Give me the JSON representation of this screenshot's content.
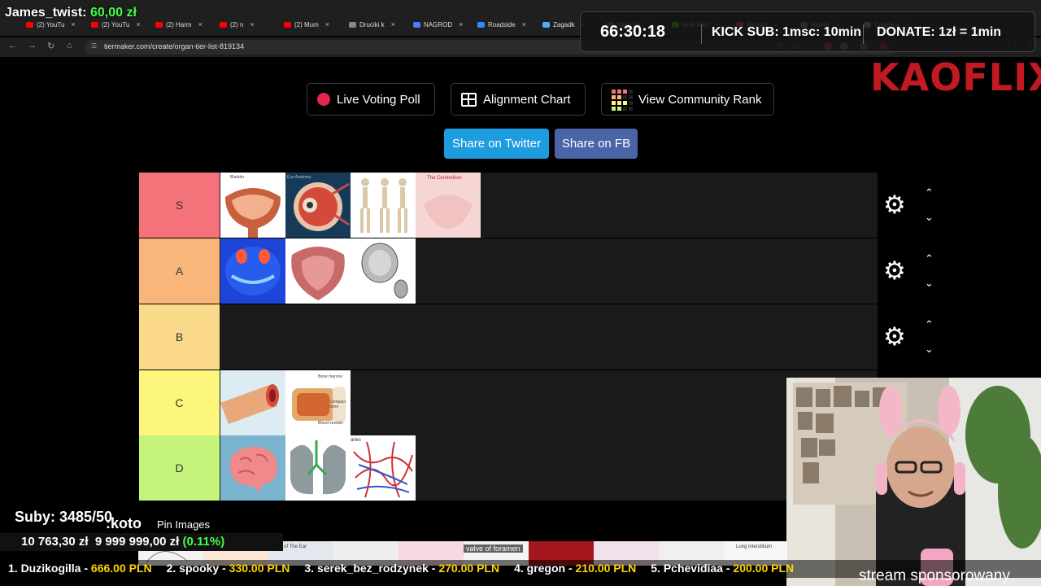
{
  "browser": {
    "tabs": [
      {
        "label": "(2) YouTu",
        "color": "#ff0000"
      },
      {
        "label": "(2) YouTu",
        "color": "#ff0000"
      },
      {
        "label": "(2) Harm",
        "color": "#ff0000"
      },
      {
        "label": "(2) n",
        "color": "#ff0000"
      },
      {
        "label": "(2) Mum",
        "color": "#ff0000"
      },
      {
        "label": "Druciki k",
        "color": "#888888"
      },
      {
        "label": "NAGROD",
        "color": "#4a7cff"
      },
      {
        "label": "Roadside",
        "color": "#2d8cff"
      },
      {
        "label": "Zagadk",
        "color": "#55aaff"
      },
      {
        "label": "New Tab",
        "color": "#44aa66"
      },
      {
        "label": "Kick Rad",
        "color": "#53fc18"
      },
      {
        "label": "Stream",
        "color": "#ff6633"
      },
      {
        "label": "Aidem",
        "color": "#999999"
      },
      {
        "label": "Create a",
        "color": "#cccccc"
      }
    ],
    "url": "tiermaker.com/create/organ-tier-list-819134"
  },
  "page": {
    "buttons": {
      "live_voting": "Live Voting Poll",
      "alignment": "Alignment Chart",
      "community": "View Community Rank",
      "twitter": "Share on Twitter",
      "facebook": "Share on FB"
    },
    "tiers": [
      {
        "label": "S",
        "color": "#f4727a"
      },
      {
        "label": "A",
        "color": "#f8b67a"
      },
      {
        "label": "B",
        "color": "#fbd98a"
      },
      {
        "label": "C",
        "color": "#fdf67c"
      },
      {
        "label": "D",
        "color": "#c4f47c"
      }
    ],
    "image_captions": {
      "bladder": "Bladder",
      "eye": "Eye Anatomy",
      "cerebellum": "The Cerebellum",
      "bone_marrow": "Bone marrow",
      "compact_bone": "Compact bone",
      "blood_vessels": "Blood vessels",
      "capillaries": "aries"
    }
  },
  "overlay": {
    "streamer": "James_twist:",
    "streamer_amount": "60,00 zł",
    "timer": "66:30:18",
    "kick_sub": "KICK SUB: 1msc: 10min",
    "donate": "DONATE: 1zł = 1min",
    "brand": "KAOFLIX",
    "subs": "Suby: 3485/50",
    "koto": ":koto",
    "pin_images": "Pin Images",
    "goal_current": "10 763,30 zł",
    "goal_target": "9 999 999,00 zł",
    "goal_percent": "(0.11%)",
    "strip_caption": "valve of foramen",
    "strip_caption2": "Lung interstitium",
    "strip_caption3": "...ny of The Ear",
    "ticker": [
      {
        "rank": "1. Duzikogilla - ",
        "amount": "666.00 PLN"
      },
      {
        "rank": "2. spooky - ",
        "amount": "330.00 PLN"
      },
      {
        "rank": "3. serek_bez_rodzynek - ",
        "amount": "270.00 PLN"
      },
      {
        "rank": "4. gregon - ",
        "amount": "210.00 PLN"
      },
      {
        "rank": "5. Pchevidiaa - ",
        "amount": "200.00 PLN"
      }
    ],
    "sponsor": "stream sponsorowany"
  }
}
